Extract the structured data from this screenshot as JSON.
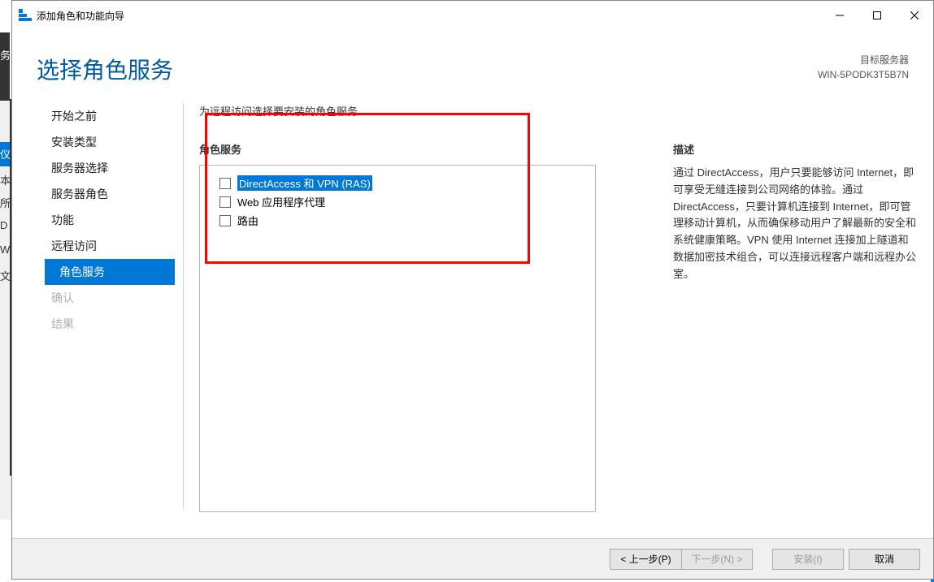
{
  "window": {
    "title": "添加角色和功能向导"
  },
  "header": {
    "page_title": "选择角色服务",
    "target_label": "目标服务器",
    "target_name": "WIN-5PODK3T5B7N"
  },
  "nav": {
    "items": [
      {
        "label": "开始之前",
        "selected": false,
        "disabled": false,
        "indented": false
      },
      {
        "label": "安装类型",
        "selected": false,
        "disabled": false,
        "indented": false
      },
      {
        "label": "服务器选择",
        "selected": false,
        "disabled": false,
        "indented": false
      },
      {
        "label": "服务器角色",
        "selected": false,
        "disabled": false,
        "indented": false
      },
      {
        "label": "功能",
        "selected": false,
        "disabled": false,
        "indented": false
      },
      {
        "label": "远程访问",
        "selected": false,
        "disabled": false,
        "indented": false
      },
      {
        "label": "角色服务",
        "selected": true,
        "disabled": false,
        "indented": true
      },
      {
        "label": "确认",
        "selected": false,
        "disabled": true,
        "indented": false
      },
      {
        "label": "结果",
        "selected": false,
        "disabled": true,
        "indented": false
      }
    ]
  },
  "content": {
    "instruction": "为远程访问选择要安装的角色服务",
    "roles_label": "角色服务",
    "roles": [
      {
        "label": "DirectAccess 和 VPN (RAS)",
        "checked": false,
        "highlighted": true
      },
      {
        "label": "Web 应用程序代理",
        "checked": false,
        "highlighted": false
      },
      {
        "label": "路由",
        "checked": false,
        "highlighted": false
      }
    ],
    "desc_label": "描述",
    "desc_text": "通过 DirectAccess，用户只要能够访问 Internet，即可享受无缝连接到公司网络的体验。通过 DirectAccess，只要计算机连接到 Internet，即可管理移动计算机，从而确保移动用户了解最新的安全和系统健康策略。VPN 使用 Internet 连接加上隧道和数据加密技术组合，可以连接远程客户端和远程办公室。"
  },
  "buttons": {
    "prev": "< 上一步(P)",
    "next": "下一步(N) >",
    "install": "安装(I)",
    "cancel": "取消"
  },
  "obscured": {
    "t0": "务",
    "t1": "仪",
    "t2": "本",
    "t3": "所",
    "t4": "D",
    "t5": "W",
    "t6": "文"
  }
}
